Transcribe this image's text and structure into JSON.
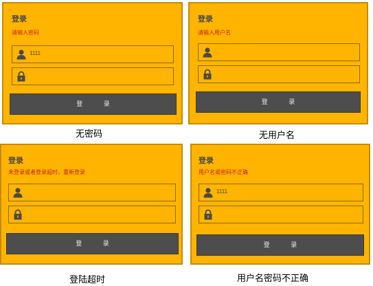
{
  "panels": [
    {
      "title": "登录",
      "error": "请输入密码",
      "username_value": "1111",
      "password_value": "",
      "button_label": "登 录",
      "caption": "无密码"
    },
    {
      "title": "登录",
      "error": "请输入用户名",
      "username_value": "",
      "password_value": "",
      "button_label": "登 录",
      "caption": "无用户名"
    },
    {
      "title": "登录",
      "error": "未登录或者登录超时，重新登录",
      "username_value": "",
      "password_value": "",
      "button_label": "登 录",
      "caption": "登陆超时"
    },
    {
      "title": "登录",
      "error": "用户名或密码不正确",
      "username_value": "1111",
      "password_value": "",
      "button_label": "登 录",
      "caption": "用户名密码不正确"
    }
  ],
  "icons": {
    "username": "user-icon",
    "password": "lock-icon"
  },
  "colors": {
    "panel_background": "#ffb400",
    "panel_border": "#c78a00",
    "error_text": "#c8200a",
    "button_background": "#4d4d4d",
    "button_text": "#e8e8e8",
    "icon_fill": "#4a4a4a"
  }
}
